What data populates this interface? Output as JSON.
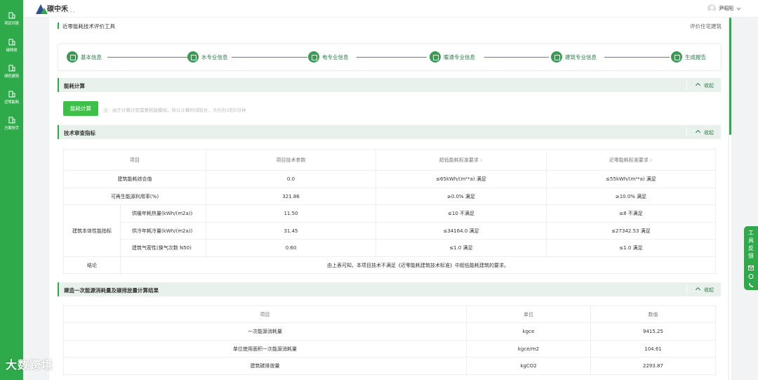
{
  "app": {
    "logo_text": "碳中禾",
    "logo_sub": "TANZHONGHE"
  },
  "sidebar": {
    "items": [
      {
        "label": "项目列表",
        "icon": "building-icon"
      },
      {
        "label": "碳排放",
        "icon": "building-icon"
      },
      {
        "label": "绿色建筑",
        "icon": "building-icon"
      },
      {
        "label": "近零能耗",
        "icon": "building-icon"
      },
      {
        "label": "方案快手",
        "icon": "building-icon"
      }
    ]
  },
  "header": {
    "user_name": "尹昭阳"
  },
  "page": {
    "title": "近零能耗技术评价工具",
    "type": "评价住宅建筑"
  },
  "steps": [
    {
      "label": "基本信息",
      "icon": "home-icon"
    },
    {
      "label": "水专业信息",
      "icon": "water-icon"
    },
    {
      "label": "电专业信息",
      "icon": "power-icon"
    },
    {
      "label": "暖通专业信息",
      "icon": "hvac-icon"
    },
    {
      "label": "建筑专业信息",
      "icon": "building-icon"
    },
    {
      "label": "生成报告",
      "icon": "report-icon"
    }
  ],
  "sections": {
    "energy_calc": {
      "title": "能耗计算",
      "collapse": "收起",
      "button": "能耗计算",
      "note": "注：由于计算过程需要耗能模拟，所以计算时间较长，大约为3到5分钟"
    },
    "tech_review": {
      "title": "技术审查指标",
      "collapse": "收起"
    },
    "primary_energy": {
      "title": "建造一次能源消耗量及碳排放量计算结果",
      "collapse": "收起"
    }
  },
  "tech_table": {
    "headers": [
      "项目",
      "项目技术参数",
      "超低能耗标准要求",
      "近零能耗标准要求"
    ],
    "rows": [
      {
        "item": "建筑能耗综合值",
        "value": "0.0",
        "ultra_low": "≤65kWh/(m²*a) 满足",
        "near_zero": "≤55kWh/(m²*a) 满足"
      },
      {
        "item": "可再生能源利用率(%)",
        "value": "321.86",
        "ultra_low": "≥0.0% 满足",
        "near_zero": "≥10.0% 满足"
      }
    ],
    "group_label": "建筑本体性能指标",
    "group_rows": [
      {
        "item": "供暖年耗热量(kWh/(m2a))",
        "value": "11.50",
        "ultra_low": "≤10 不满足",
        "near_zero": "≤8 不满足"
      },
      {
        "item": "供冷年耗冷量(kWh/(m2a))",
        "value": "31.45",
        "ultra_low": "≤34164.0 满足",
        "near_zero": "≤27342.53 满足"
      },
      {
        "item": "建筑气密性(换气次数 N50)",
        "value": "0.60",
        "ultra_low": "≤1.0 满足",
        "near_zero": "≤1.0 满足"
      }
    ],
    "conclusion_label": "结论",
    "conclusion": "由上表可知，本项目技术不满足《近零能耗建筑技术标准》中超低能耗建筑的要求。"
  },
  "energy_table": {
    "headers": [
      "项目",
      "单位",
      "数值"
    ],
    "rows": [
      {
        "item": "一次能源消耗量",
        "unit": "kgce",
        "value": "9415.25"
      },
      {
        "item": "单位使用面积一次能源消耗量",
        "unit": "kgce/m2",
        "value": "104.61"
      },
      {
        "item": "建筑碳排放量",
        "unit": "kgCO2",
        "value": "2293.87"
      }
    ]
  },
  "feedback": {
    "label": "工具反馈"
  },
  "watermark": "大数跨境",
  "colors": {
    "brand": "#2eaa4a",
    "step": "#3d9a55",
    "section_bg": "#e8f1ec",
    "button": "#3cc04a"
  }
}
